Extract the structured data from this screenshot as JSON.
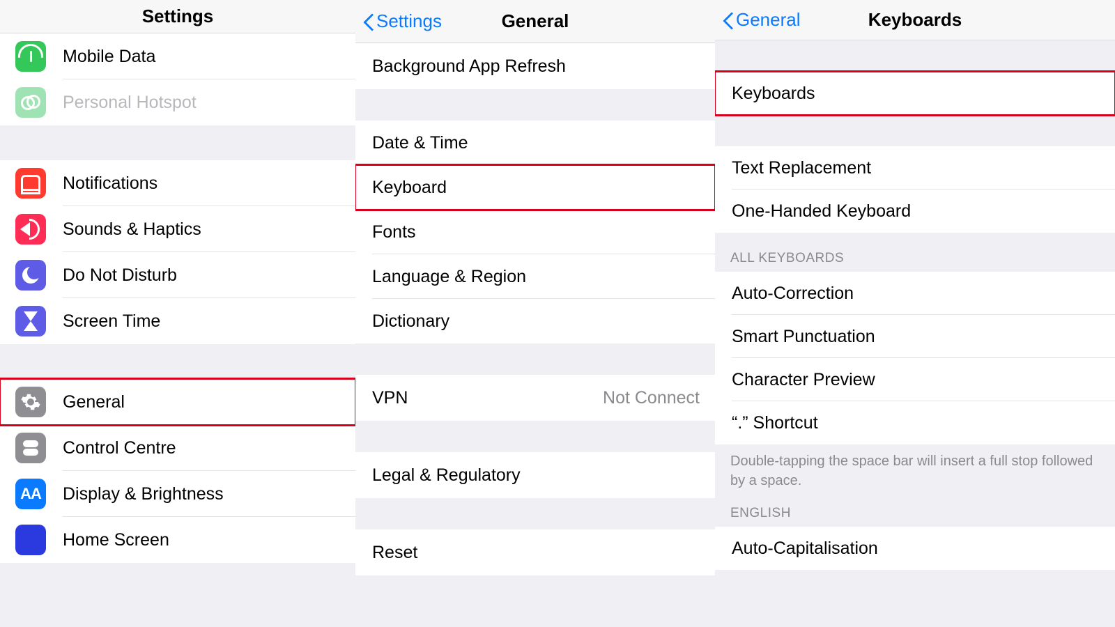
{
  "pane1": {
    "nav_title": "Settings",
    "group_a": [
      {
        "id": "mobile-data",
        "label": "Mobile Data",
        "icon": "antenna",
        "color": "#34C759"
      },
      {
        "id": "personal-hotspot",
        "label": "Personal Hotspot",
        "icon": "link",
        "color": "#9FE3B4",
        "disabled": true
      }
    ],
    "group_b": [
      {
        "id": "notifications",
        "label": "Notifications",
        "icon": "bell",
        "color": "#FF3B30"
      },
      {
        "id": "sounds-haptics",
        "label": "Sounds & Haptics",
        "icon": "sound",
        "color": "#FF2D55"
      },
      {
        "id": "do-not-disturb",
        "label": "Do Not Disturb",
        "icon": "moon",
        "color": "#5E5CE6"
      },
      {
        "id": "screen-time",
        "label": "Screen Time",
        "icon": "hourglass",
        "color": "#5E5CE6"
      }
    ],
    "group_c": [
      {
        "id": "general",
        "label": "General",
        "icon": "gear",
        "color": "#8E8E93",
        "highlight": true
      },
      {
        "id": "control-centre",
        "label": "Control Centre",
        "icon": "toggles",
        "color": "#8E8E93"
      },
      {
        "id": "display-brightness",
        "label": "Display & Brightness",
        "icon": "aa",
        "color": "#0A7AFF"
      },
      {
        "id": "home-screen",
        "label": "Home Screen",
        "icon": "grid",
        "color": "#2B3ADF"
      }
    ]
  },
  "pane2": {
    "nav_back": "Settings",
    "nav_title": "General",
    "group_a": [
      {
        "id": "background-app-refresh",
        "label": "Background App Refresh"
      }
    ],
    "group_b": [
      {
        "id": "date-time",
        "label": "Date & Time"
      },
      {
        "id": "keyboard",
        "label": "Keyboard",
        "highlight": true
      },
      {
        "id": "fonts",
        "label": "Fonts"
      },
      {
        "id": "language-region",
        "label": "Language & Region"
      },
      {
        "id": "dictionary",
        "label": "Dictionary"
      }
    ],
    "group_c": [
      {
        "id": "vpn",
        "label": "VPN",
        "value": "Not Connect"
      }
    ],
    "group_d": [
      {
        "id": "legal-regulatory",
        "label": "Legal & Regulatory"
      }
    ],
    "group_e": [
      {
        "id": "reset",
        "label": "Reset"
      }
    ]
  },
  "pane3": {
    "nav_back": "General",
    "nav_title": "Keyboards",
    "group_a": [
      {
        "id": "keyboards",
        "label": "Keyboards",
        "highlight": true
      }
    ],
    "group_b": [
      {
        "id": "text-replacement",
        "label": "Text Replacement"
      },
      {
        "id": "one-handed-keyboard",
        "label": "One-Handed Keyboard"
      }
    ],
    "section_all_hdr": "ALL KEYBOARDS",
    "group_c": [
      {
        "id": "auto-correction",
        "label": "Auto-Correction"
      },
      {
        "id": "smart-punctuation",
        "label": "Smart Punctuation"
      },
      {
        "id": "character-preview",
        "label": "Character Preview"
      },
      {
        "id": "dot-shortcut",
        "label": "“.” Shortcut"
      }
    ],
    "section_c_ftr": "Double-tapping the space bar will insert a full stop followed by a space.",
    "section_en_hdr": "ENGLISH",
    "group_d": [
      {
        "id": "auto-capitalisation",
        "label": "Auto-Capitalisation"
      }
    ]
  }
}
